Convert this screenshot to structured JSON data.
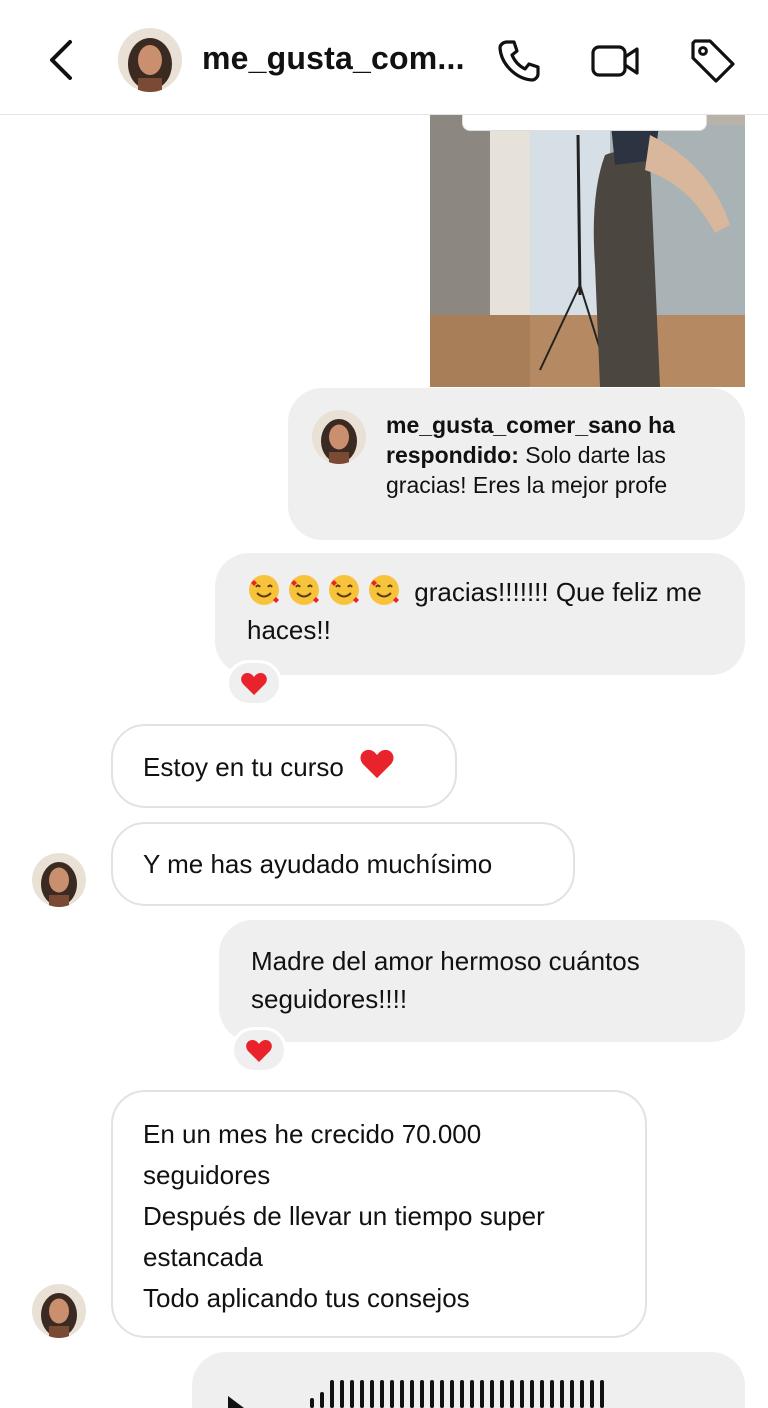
{
  "header": {
    "username": "me_gusta_com...",
    "back_icon": "chevron-left-icon",
    "call_icon": "phone-icon",
    "video_icon": "video-camera-icon",
    "tag_icon": "tag-icon"
  },
  "reply": {
    "author": "me_gusta_comer_sano ha respondido:",
    "text": "Solo darte las gracias! Eres la mejor profe"
  },
  "messages": [
    {
      "from": "me",
      "text": "gracias!!!!!!! Que feliz me haces!!",
      "emoji": "smiling-face-with-hearts x4",
      "reaction": "heart"
    },
    {
      "from": "them",
      "text": "Estoy en tu curso",
      "emoji": "heart"
    },
    {
      "from": "them",
      "text": "Y me has ayudado muchísimo"
    },
    {
      "from": "me",
      "text_line1": "Madre del amor hermoso cuántos",
      "text_line2": "seguidores!!!!",
      "reaction": "heart"
    },
    {
      "from": "them",
      "lines": [
        "En un mes he crecido 70.000",
        "seguidores",
        "Después de llevar un tiempo super",
        "estancada",
        "Todo aplicando tus consejos"
      ]
    },
    {
      "from": "me",
      "type": "voice-message"
    }
  ],
  "colors": {
    "outgoing_bubble": "#efefef",
    "incoming_border": "#e2e2e2",
    "heart": "#e8232b"
  }
}
